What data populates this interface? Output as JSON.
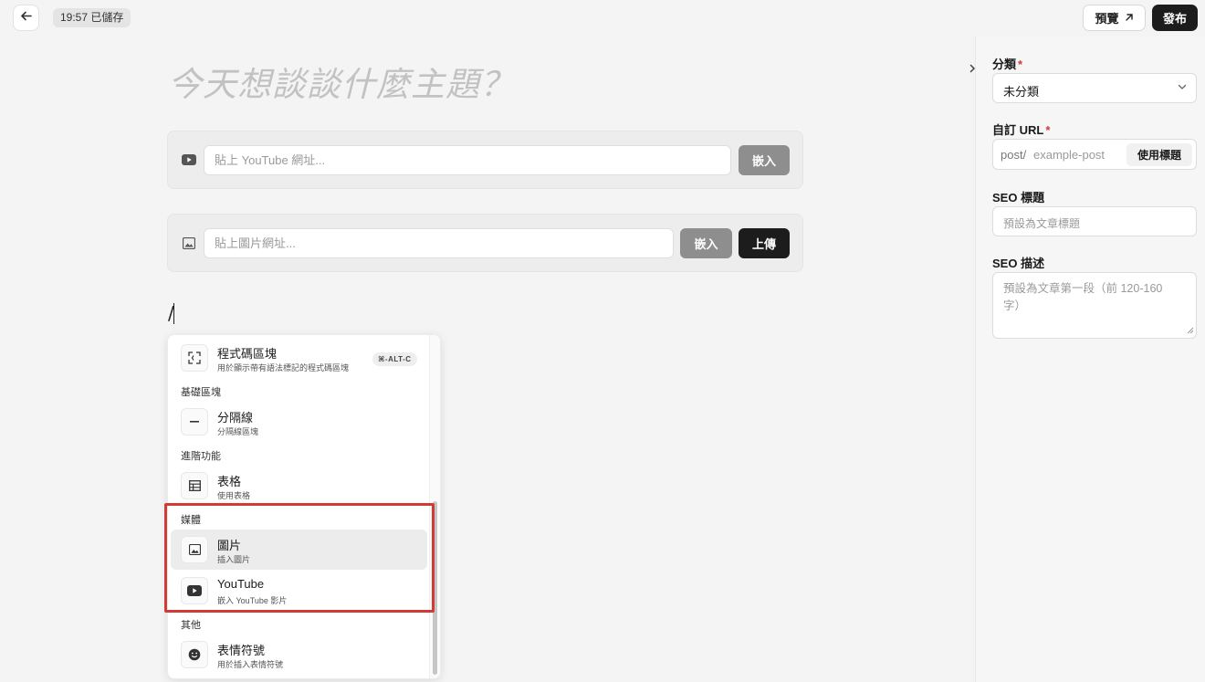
{
  "topbar": {
    "save_status": "19:57 已儲存",
    "preview_label": "預覽",
    "publish_label": "發布"
  },
  "editor": {
    "title_placeholder": "今天想談談什麼主題？",
    "youtube_embed": {
      "placeholder": "貼上 YouTube 網址...",
      "embed_label": "嵌入"
    },
    "image_embed": {
      "placeholder": "貼上圖片網址...",
      "embed_label": "嵌入",
      "upload_label": "上傳"
    },
    "slash_text": "/"
  },
  "slash_menu": {
    "items": [
      {
        "title": "程式碼區塊",
        "desc": "用於顯示帶有語法標記的程式碼區塊",
        "shortcut": "⌘-ALT-C",
        "icon": "code-block-icon"
      },
      {
        "group": "基礎區塊"
      },
      {
        "title": "分隔線",
        "desc": "分隔線區塊",
        "icon": "divider-icon"
      },
      {
        "group": "進階功能"
      },
      {
        "title": "表格",
        "desc": "使用表格",
        "icon": "table-icon"
      },
      {
        "group": "媒體"
      },
      {
        "title": "圖片",
        "desc": "插入圖片",
        "icon": "image-icon",
        "highlighted": true
      },
      {
        "title": "YouTube",
        "desc": "嵌入 YouTube 影片",
        "icon": "youtube-icon"
      },
      {
        "group": "其他"
      },
      {
        "title": "表情符號",
        "desc": "用於插入表情符號",
        "icon": "emoji-icon"
      }
    ]
  },
  "side_panel": {
    "category_label": "分類",
    "category_value": "未分類",
    "url_label": "自訂 URL",
    "url_prefix": "post/",
    "url_placeholder": "example-post",
    "url_button": "使用標題",
    "seo_title_label": "SEO 標題",
    "seo_title_placeholder": "預設為文章標題",
    "seo_desc_label": "SEO 描述",
    "seo_desc_placeholder": "預設為文章第一段（前 120-160 字）",
    "required_mark": "*"
  },
  "colors": {
    "accent_dark": "#1c1c1c",
    "required": "#d23a35",
    "highlight_border": "#d23a35"
  }
}
